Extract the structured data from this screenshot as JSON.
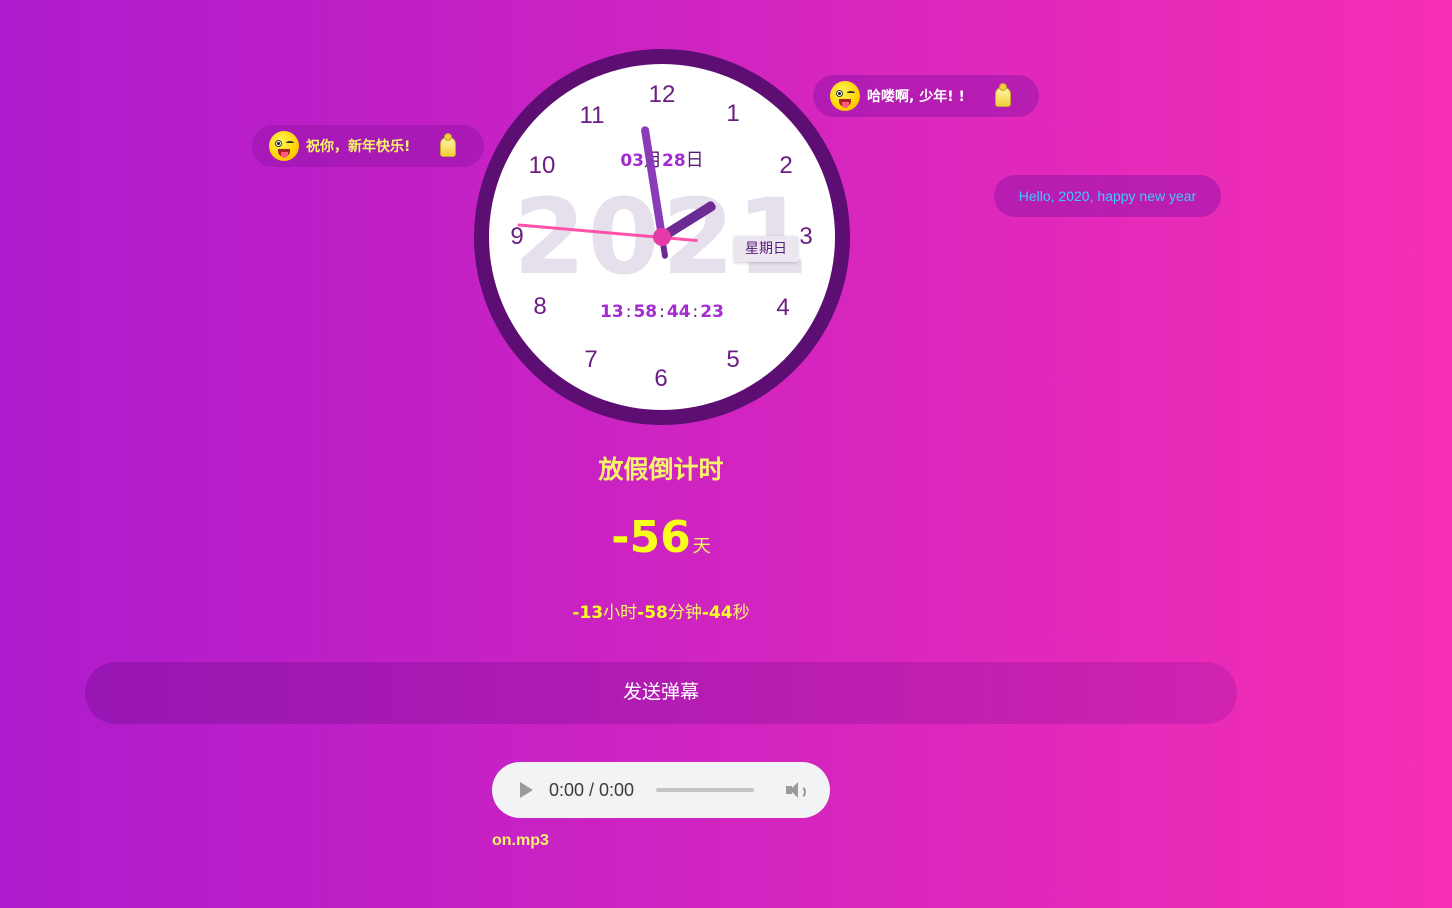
{
  "danmaku": [
    {
      "text": "祝你，新年快乐!",
      "color": "#f7f36a"
    },
    {
      "text": "哈喽啊, 少年! !",
      "color": "#ffffff"
    },
    {
      "text": "Hello, 2020, happy new year",
      "color": "#3ec9ff"
    }
  ],
  "clock": {
    "numbers": [
      "12",
      "1",
      "2",
      "3",
      "4",
      "5",
      "6",
      "7",
      "8",
      "9",
      "10",
      "11"
    ],
    "year_watermark": "2021",
    "month": "03",
    "month_unit": "月",
    "day": "28",
    "day_unit": "日",
    "weekday": "星期日",
    "digital": {
      "h": "13",
      "m": "58",
      "s": "44",
      "ms": "23",
      "sep": ":"
    }
  },
  "countdown": {
    "title": "放假倒计时",
    "days": "-56",
    "days_unit": "天",
    "hours": "-13",
    "hours_unit": "小时",
    "minutes": "-58",
    "minutes_unit": "分钟",
    "seconds": "-44",
    "seconds_unit": "秒"
  },
  "send_button": "发送弹幕",
  "audio": {
    "time": "0:00 / 0:00",
    "filename": "on.mp3"
  },
  "colors": {
    "bg_start": "#ad1bcd",
    "bg_end": "#f62eb4",
    "accent_yellow": "#f7ff1a",
    "clock_ring": "#5c0e73"
  }
}
